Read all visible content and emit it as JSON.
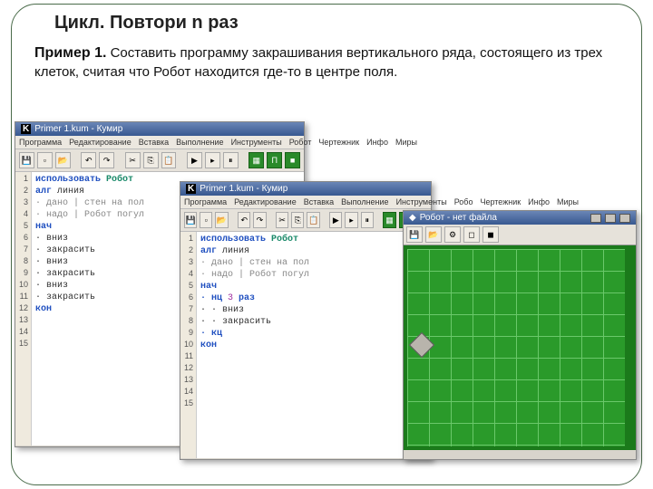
{
  "slide": {
    "title": "Цикл. Повтори n раз",
    "example_label": "Пример 1.",
    "task": "Составить программу закрашивания вертикального ряда, состоящего из трех клеток, считая что Робот находится где-то в центре поля."
  },
  "window1": {
    "title": "Primer 1.kum - Кумир",
    "menu": [
      "Программа",
      "Редактирование",
      "Вставка",
      "Выполнение",
      "Инструменты",
      "Робот",
      "Чертежник",
      "Инфо",
      "Миры"
    ],
    "code": {
      "l1a": "использовать ",
      "l1b": "Робот",
      "l2a": "алг ",
      "l2b": "линия",
      "l3": "· дано | стен на пол",
      "l4": "· надо | Робот погул",
      "l5": "нач",
      "l6": "· вниз",
      "l7": "· закрасить",
      "l8": "· вниз",
      "l9": "· закрасить",
      "l10": "· вниз",
      "l11": "· закрасить",
      "l12": "кон"
    }
  },
  "window2": {
    "title": "Primer 1.kum - Кумир",
    "menu": [
      "Программа",
      "Редактирование",
      "Вставка",
      "Выполнение",
      "Инструменты",
      "Робо",
      "Чертежник",
      "Инфо",
      "Миры"
    ],
    "code": {
      "l1a": "использовать ",
      "l1b": "Робот",
      "l2a": "алг ",
      "l2b": "линия",
      "l3": "· дано | стен на пол",
      "l4": "· надо | Робот погул",
      "l5": "нач",
      "l6a": "· нц ",
      "l6b": "3",
      "l6c": " раз",
      "l7": "· · вниз",
      "l8": "· · закрасить",
      "l9": "· кц",
      "l10": "кон"
    }
  },
  "window3": {
    "title": "Робот - нет файла"
  },
  "line_numbers": [
    "1",
    "2",
    "3",
    "4",
    "5",
    "6",
    "7",
    "8",
    "9",
    "10",
    "11",
    "12",
    "13",
    "14",
    "15"
  ]
}
